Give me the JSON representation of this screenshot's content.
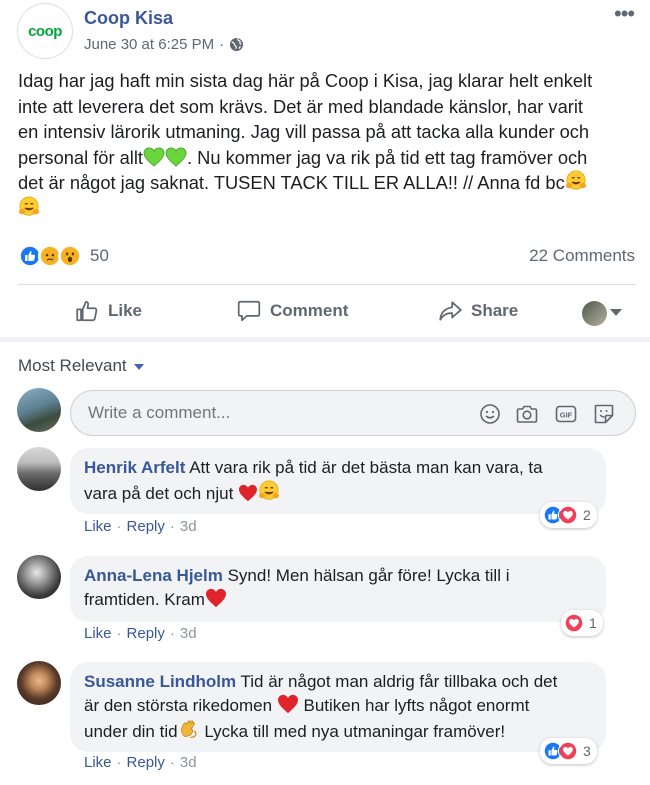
{
  "post": {
    "page_name": "Coop Kisa",
    "logo_text": "coop",
    "date": "June 30 at 6:25 PM",
    "separator": "·",
    "text_lines": [
      "Idag har jag haft min sista dag här på Coop i Kisa, jag klarar helt enkelt",
      "inte att leverera det som krävs. Det är med blandade känslor, har varit",
      "en intensiv lärorik utmaning. Jag vill passa på att tacka alla kunder och",
      "personal för allt",
      ". Nu kommer jag va rik på tid ett tag framöver och",
      "det är något jag saknat. TUSEN TACK TILL ER ALLA!! // Anna fd bc"
    ],
    "reaction_count": "50",
    "comments_count": "22 Comments"
  },
  "actions": {
    "like": "Like",
    "comment": "Comment",
    "share": "Share"
  },
  "sort_label": "Most Relevant",
  "composer": {
    "placeholder": "Write a comment..."
  },
  "comments": [
    {
      "author": "Henrik Arfelt",
      "text_1": "Att vara rik på tid är det bästa man kan vara, ta",
      "text_2": "vara på det och njut",
      "like": "Like",
      "reply": "Reply",
      "time": "3d",
      "reactions": "2"
    },
    {
      "author": "Anna-Lena Hjelm",
      "text_1": "Synd! Men hälsan går före! Lycka till i",
      "text_2": "framtiden. Kram",
      "like": "Like",
      "reply": "Reply",
      "time": "3d",
      "reactions": "1"
    },
    {
      "author": "Susanne Lindholm",
      "text_1": "Tid är något man aldrig får tillbaka och det",
      "text_2": "är den största rikedomen",
      "text_3": "Butiken har lyfts något enormt",
      "text_4": "under din tid",
      "text_5": "Lycka till med nya utmaningar framöver!",
      "like": "Like",
      "reply": "Reply",
      "time": "3d",
      "reactions": "3"
    }
  ],
  "colors": {
    "link": "#385898",
    "brand_green": "#00a53c",
    "like_blue": "#1877f2",
    "love_red": "#f33e58"
  }
}
